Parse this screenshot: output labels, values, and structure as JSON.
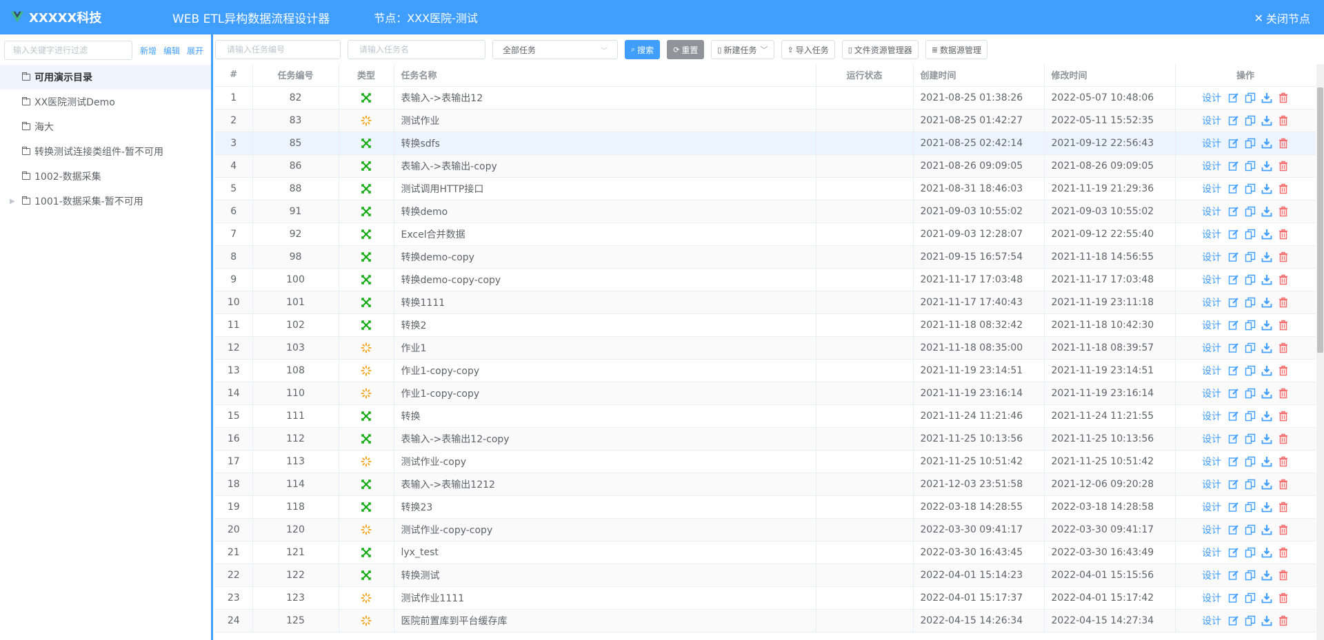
{
  "header": {
    "logo_text": "XXXXX科技",
    "app_title": "WEB ETL异构数据流程设计器",
    "node_info": "节点：XXX医院-测试",
    "close_label": "关闭节点"
  },
  "sidebar": {
    "filter_placeholder": "输入关键字进行过滤",
    "add_label": "新增",
    "edit_label": "编辑",
    "expand_label": "展开",
    "items": [
      {
        "label": "可用演示目录",
        "active": true,
        "expandable": false
      },
      {
        "label": "XX医院测试Demo",
        "active": false,
        "expandable": false
      },
      {
        "label": "海大",
        "active": false,
        "expandable": false
      },
      {
        "label": "转换测试连接类组件-暂不可用",
        "active": false,
        "expandable": false
      },
      {
        "label": "1002-数据采集",
        "active": false,
        "expandable": false
      },
      {
        "label": "1001-数据采集-暂不可用",
        "active": false,
        "expandable": true
      }
    ]
  },
  "toolbar": {
    "task_id_placeholder": "请输入任务编号",
    "task_name_placeholder": "请输入任务名",
    "task_filter_value": "全部任务",
    "search_label": "搜索",
    "reset_label": "重置",
    "new_task_label": "新建任务",
    "import_label": "导入任务",
    "file_manager_label": "文件资源管理器",
    "datasource_label": "数据源管理"
  },
  "table": {
    "columns": {
      "index": "#",
      "task_id": "任务编号",
      "type": "类型",
      "name": "任务名称",
      "status": "运行状态",
      "created": "创建时间",
      "modified": "修改时间",
      "actions": "操作"
    },
    "design_label": "设计",
    "colors": {
      "transform": "#1aad19",
      "job": "#f5a623",
      "delete": "#f56c6c",
      "action": "#409eff"
    },
    "rows": [
      {
        "idx": "1",
        "id": "82",
        "type": "transform",
        "name": "表输入->表输出12",
        "created": "2021-08-25 01:38:26",
        "modified": "2022-05-07 10:48:06"
      },
      {
        "idx": "2",
        "id": "83",
        "type": "job",
        "name": "测试作业",
        "created": "2021-08-25 01:42:27",
        "modified": "2022-05-11 15:52:35"
      },
      {
        "idx": "3",
        "id": "85",
        "type": "transform",
        "name": "转换sdfs",
        "created": "2021-08-25 02:42:14",
        "modified": "2021-09-12 22:56:43"
      },
      {
        "idx": "4",
        "id": "86",
        "type": "transform",
        "name": "表输入->表输出-copy",
        "created": "2021-08-26 09:09:05",
        "modified": "2021-08-26 09:09:05"
      },
      {
        "idx": "5",
        "id": "88",
        "type": "transform",
        "name": "测试调用HTTP接口",
        "created": "2021-08-31 18:46:03",
        "modified": "2021-11-19 21:29:36"
      },
      {
        "idx": "6",
        "id": "91",
        "type": "transform",
        "name": "转换demo",
        "created": "2021-09-03 10:55:02",
        "modified": "2021-09-03 10:55:02"
      },
      {
        "idx": "7",
        "id": "92",
        "type": "transform",
        "name": "Excel合并数据",
        "created": "2021-09-03 12:28:07",
        "modified": "2021-09-12 22:55:40"
      },
      {
        "idx": "8",
        "id": "98",
        "type": "transform",
        "name": "转换demo-copy",
        "created": "2021-09-15 16:57:54",
        "modified": "2021-11-18 14:56:55"
      },
      {
        "idx": "9",
        "id": "100",
        "type": "transform",
        "name": "转换demo-copy-copy",
        "created": "2021-11-17 17:03:48",
        "modified": "2021-11-17 17:03:48"
      },
      {
        "idx": "10",
        "id": "101",
        "type": "transform",
        "name": "转换1111",
        "created": "2021-11-17 17:40:43",
        "modified": "2021-11-19 23:11:18"
      },
      {
        "idx": "11",
        "id": "102",
        "type": "transform",
        "name": "转换2",
        "created": "2021-11-18 08:32:42",
        "modified": "2021-11-18 10:42:30"
      },
      {
        "idx": "12",
        "id": "103",
        "type": "job",
        "name": "作业1",
        "created": "2021-11-18 08:35:00",
        "modified": "2021-11-18 08:39:57"
      },
      {
        "idx": "13",
        "id": "108",
        "type": "job",
        "name": "作业1-copy-copy",
        "created": "2021-11-19 23:14:51",
        "modified": "2021-11-19 23:14:51"
      },
      {
        "idx": "14",
        "id": "110",
        "type": "job",
        "name": "作业1-copy-copy",
        "created": "2021-11-19 23:16:14",
        "modified": "2021-11-19 23:16:14"
      },
      {
        "idx": "15",
        "id": "111",
        "type": "transform",
        "name": "转换",
        "created": "2021-11-24 11:21:46",
        "modified": "2021-11-24 11:21:55"
      },
      {
        "idx": "16",
        "id": "112",
        "type": "transform",
        "name": "表输入->表输出12-copy",
        "created": "2021-11-25 10:13:56",
        "modified": "2021-11-25 10:13:56"
      },
      {
        "idx": "17",
        "id": "113",
        "type": "job",
        "name": "测试作业-copy",
        "created": "2021-11-25 10:51:42",
        "modified": "2021-11-25 10:51:42"
      },
      {
        "idx": "18",
        "id": "114",
        "type": "transform",
        "name": "表输入->表输出1212",
        "created": "2021-12-03 23:51:58",
        "modified": "2021-12-06 09:20:28"
      },
      {
        "idx": "19",
        "id": "118",
        "type": "transform",
        "name": "转换23",
        "created": "2022-03-18 14:28:55",
        "modified": "2022-03-18 14:28:58"
      },
      {
        "idx": "20",
        "id": "120",
        "type": "job",
        "name": "测试作业-copy-copy",
        "created": "2022-03-30 09:41:17",
        "modified": "2022-03-30 09:41:17"
      },
      {
        "idx": "21",
        "id": "121",
        "type": "transform",
        "name": "lyx_test",
        "created": "2022-03-30 16:43:45",
        "modified": "2022-03-30 16:43:49"
      },
      {
        "idx": "22",
        "id": "122",
        "type": "transform",
        "name": "转换测试",
        "created": "2022-04-01 15:14:23",
        "modified": "2022-04-01 15:15:56"
      },
      {
        "idx": "23",
        "id": "123",
        "type": "job",
        "name": "测试作业1111",
        "created": "2022-04-01 15:17:37",
        "modified": "2022-04-01 15:17:42"
      },
      {
        "idx": "24",
        "id": "125",
        "type": "job",
        "name": "医院前置库到平台缓存库",
        "created": "2022-04-15 14:26:34",
        "modified": "2022-04-15 14:27:34"
      }
    ]
  }
}
